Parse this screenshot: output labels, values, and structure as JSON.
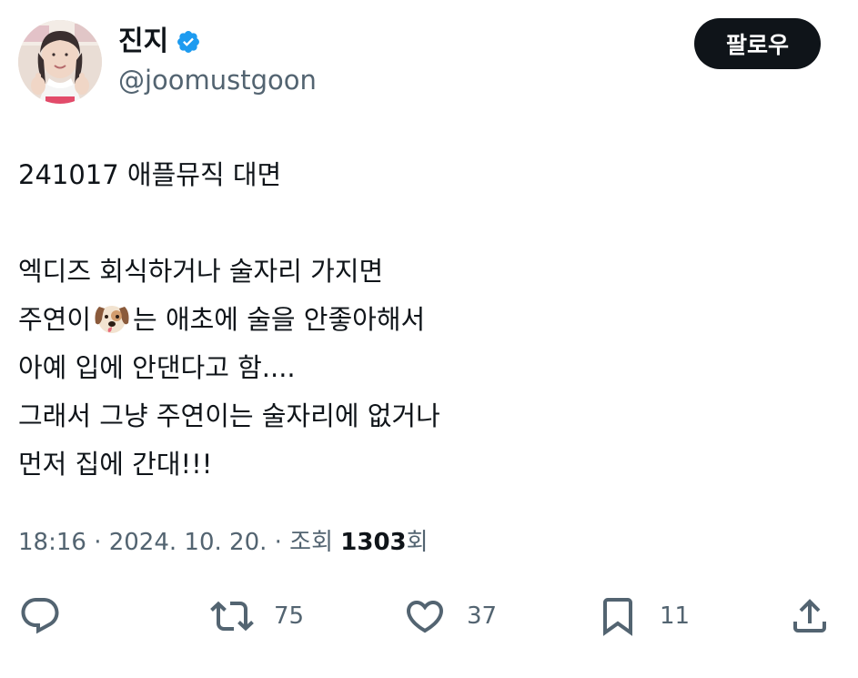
{
  "user": {
    "display_name": "진지",
    "handle": "@joomustgoon",
    "verified_icon": "verified-badge-icon",
    "verified_color": "#1d9bf0"
  },
  "follow_button": {
    "label": "팔로우"
  },
  "tweet": {
    "lines": [
      "241017 애플뮤직 대면",
      "",
      "엑디즈 회식하거나 술자리 가지면",
      "주연이",
      "는 애초에 술을 안좋아해서",
      "아예 입에 안댄다고 함....",
      "그래서 그냥 주연이는 술자리에 없거나",
      "먼저 집에 간대!!!"
    ],
    "emoji": "dog-face-emoji"
  },
  "meta": {
    "time": "18:16 · 2024. 10. 20. · 조회 ",
    "views": "1303",
    "views_suffix": "회"
  },
  "actions": {
    "reply": {
      "icon": "reply-icon"
    },
    "retweet": {
      "icon": "retweet-icon",
      "count": "75"
    },
    "like": {
      "icon": "heart-icon",
      "count": "37"
    },
    "bookmark": {
      "icon": "bookmark-icon",
      "count": "11"
    },
    "share": {
      "icon": "share-icon"
    }
  },
  "colors": {
    "text": "#0f1419",
    "secondary": "#536471",
    "button_bg": "#0f1419",
    "verified": "#1d9bf0"
  }
}
